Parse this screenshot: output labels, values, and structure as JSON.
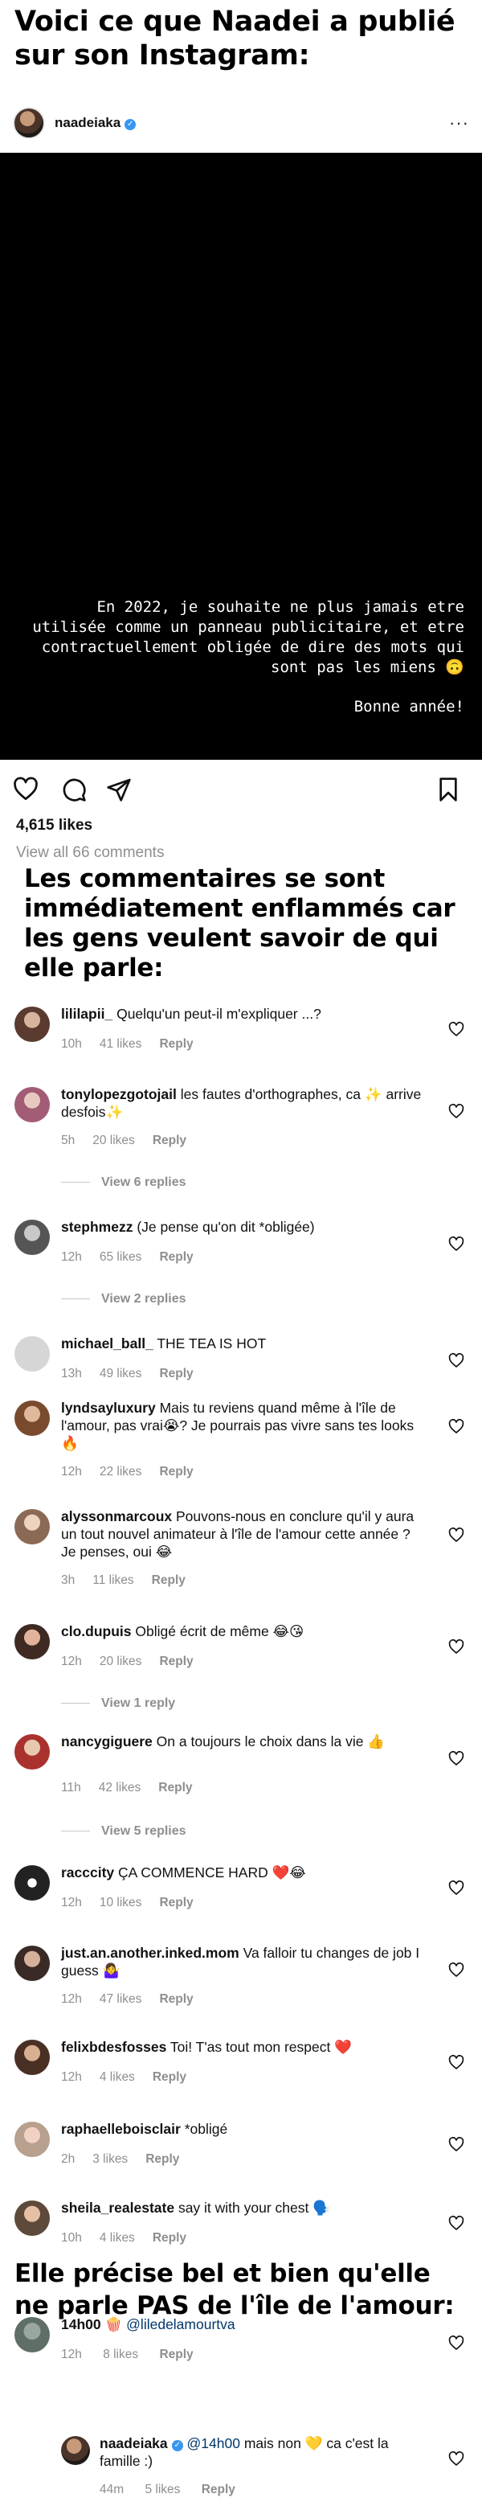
{
  "headline_1": "Voici ce que Naadei a publié sur son Instagram:",
  "post": {
    "username": "naadeiaka",
    "verified_glyph": "✓",
    "more_glyph": "···",
    "image_text": "En 2022, je souhaite ne plus jamais etre utilisée comme un panneau publicitaire, et etre contractuellement obligée de dire des mots qui sont pas les miens 🙃",
    "image_signoff": "Bonne année!",
    "likes": "4,615 likes",
    "view_all_comments": "View all 66 comments"
  },
  "icons": [
    "heart-icon",
    "comment-icon",
    "share-icon",
    "bookmark-icon",
    "more-icon",
    "verified-icon"
  ],
  "headline_2": "Les commentaires se sont immédiatement enflammés car les gens veulent savoir de qui elle parle:",
  "comments": [
    {
      "user": "lililapii_",
      "text": "Quelqu'un peut-il m'expliquer ...?",
      "time": "10h",
      "likes": "41 likes",
      "reply": "Reply"
    },
    {
      "user": "tonylopezgotojail",
      "text": "les fautes d'orthographes, ca ✨ arrive desfois✨",
      "time": "5h",
      "likes": "20 likes",
      "reply": "Reply",
      "view_replies": "View 6 replies"
    },
    {
      "user": "stephmezz",
      "text": "(Je pense qu'on dit *obligée)",
      "time": "12h",
      "likes": "65 likes",
      "reply": "Reply",
      "view_replies": "View 2 replies"
    },
    {
      "user": "michael_ball_",
      "text": "THE TEA IS HOT",
      "time": "13h",
      "likes": "49 likes",
      "reply": "Reply"
    },
    {
      "user": "lyndsayluxury",
      "text": "Mais tu reviens quand même à l'île de l'amour, pas vrai😭? Je pourrais pas vivre sans tes looks 🔥",
      "time": "12h",
      "likes": "22 likes",
      "reply": "Reply"
    },
    {
      "user": "alyssonmarcoux",
      "text": "Pouvons-nous en conclure qu'il y aura un tout nouvel animateur à l'île de l'amour cette année ? Je penses, oui 😂",
      "time": "3h",
      "likes": "11 likes",
      "reply": "Reply"
    },
    {
      "user": "clo.dupuis",
      "text": "Obligé écrit de même 😂😘",
      "time": "12h",
      "likes": "20 likes",
      "reply": "Reply",
      "view_replies": "View 1 reply"
    },
    {
      "user": "nancygiguere",
      "text": "On a toujours le choix dans la vie 👍",
      "time": "11h",
      "likes": "42 likes",
      "reply": "Reply",
      "view_replies": "View 5 replies"
    },
    {
      "user": "racccity",
      "text": "ÇA COMMENCE HARD ❤️😂",
      "time": "12h",
      "likes": "10 likes",
      "reply": "Reply"
    },
    {
      "user": "just.an.another.inked.mom",
      "text": "Va falloir tu changes de job I guess 🤷‍♀️",
      "time": "12h",
      "likes": "47 likes",
      "reply": "Reply"
    },
    {
      "user": "felixbdesfosses",
      "text": "Toi! T'as tout mon respect ❤️",
      "time": "12h",
      "likes": "4 likes",
      "reply": "Reply"
    },
    {
      "user": "raphaelleboisclair",
      "text": "*obligé",
      "time": "2h",
      "likes": "3 likes",
      "reply": "Reply"
    },
    {
      "user": "sheila_realestate",
      "text": "say it with your chest 🗣️",
      "time": "10h",
      "likes": "4 likes",
      "reply": "Reply"
    }
  ],
  "headline_3": "Elle précise bel et bien qu'elle ne parle PAS de l'île de l'amour:",
  "thread": {
    "user": "14h00",
    "emoji": "🍿",
    "mention": "@liledelamourtva",
    "time": "12h",
    "likes": "8 likes",
    "reply": "Reply",
    "reply_comment": {
      "user": "naadeiaka",
      "mention": "@14h00",
      "text": "mais non 💛 ca c'est la famille :)",
      "time": "44m",
      "likes": "5 likes",
      "reply": "Reply"
    }
  },
  "colors": {
    "meta_gray": "#8e8e8e",
    "verified_blue": "#3897f0",
    "link_blue": "#00376b"
  }
}
